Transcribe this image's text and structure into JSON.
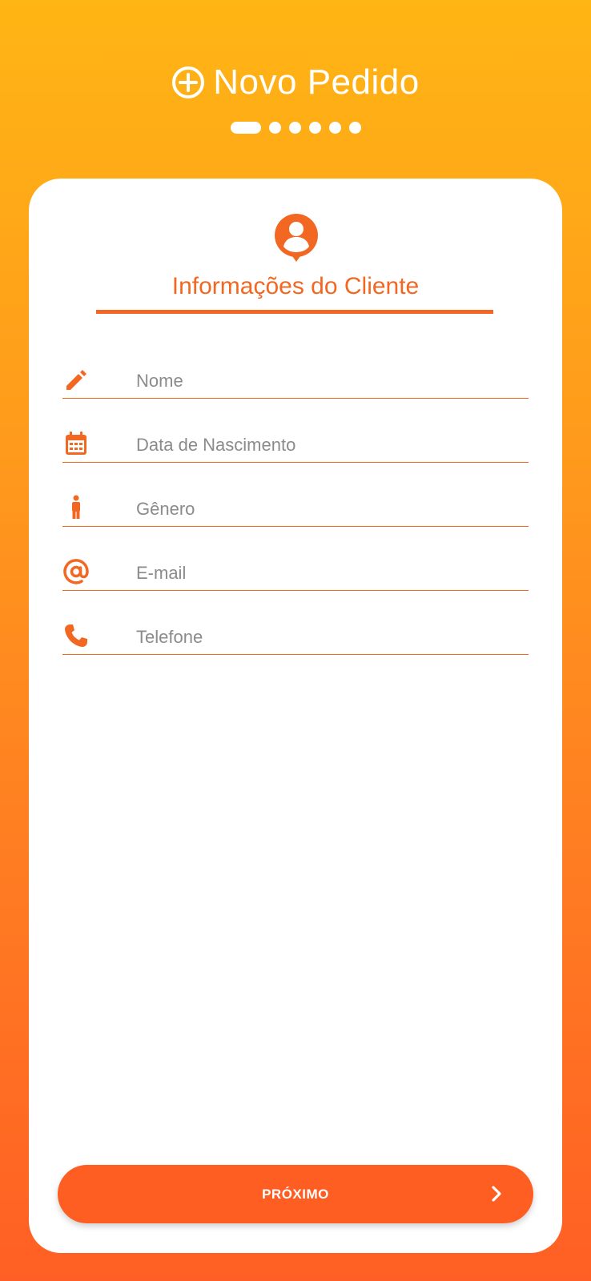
{
  "header": {
    "title": "Novo Pedido",
    "icon": "plus-circle-icon"
  },
  "pager": {
    "total_steps": 6,
    "current_step": 1
  },
  "card": {
    "title": "Informações do Cliente",
    "icon": "person-pin-icon"
  },
  "form": {
    "fields": [
      {
        "label": "Nome",
        "icon": "pencil-icon"
      },
      {
        "label": "Data de Nascimento",
        "icon": "calendar-icon"
      },
      {
        "label": "Gênero",
        "icon": "person-icon"
      },
      {
        "label": "E-mail",
        "icon": "at-sign-icon"
      },
      {
        "label": "Telefone",
        "icon": "phone-icon"
      }
    ]
  },
  "actions": {
    "next_label": "PRÓXIMO",
    "next_icon": "chevron-right-icon"
  },
  "colors": {
    "accent": "#F26822",
    "button": "#FF5E22",
    "gradient_top": "#FFB514",
    "gradient_bottom": "#FF5F24"
  }
}
